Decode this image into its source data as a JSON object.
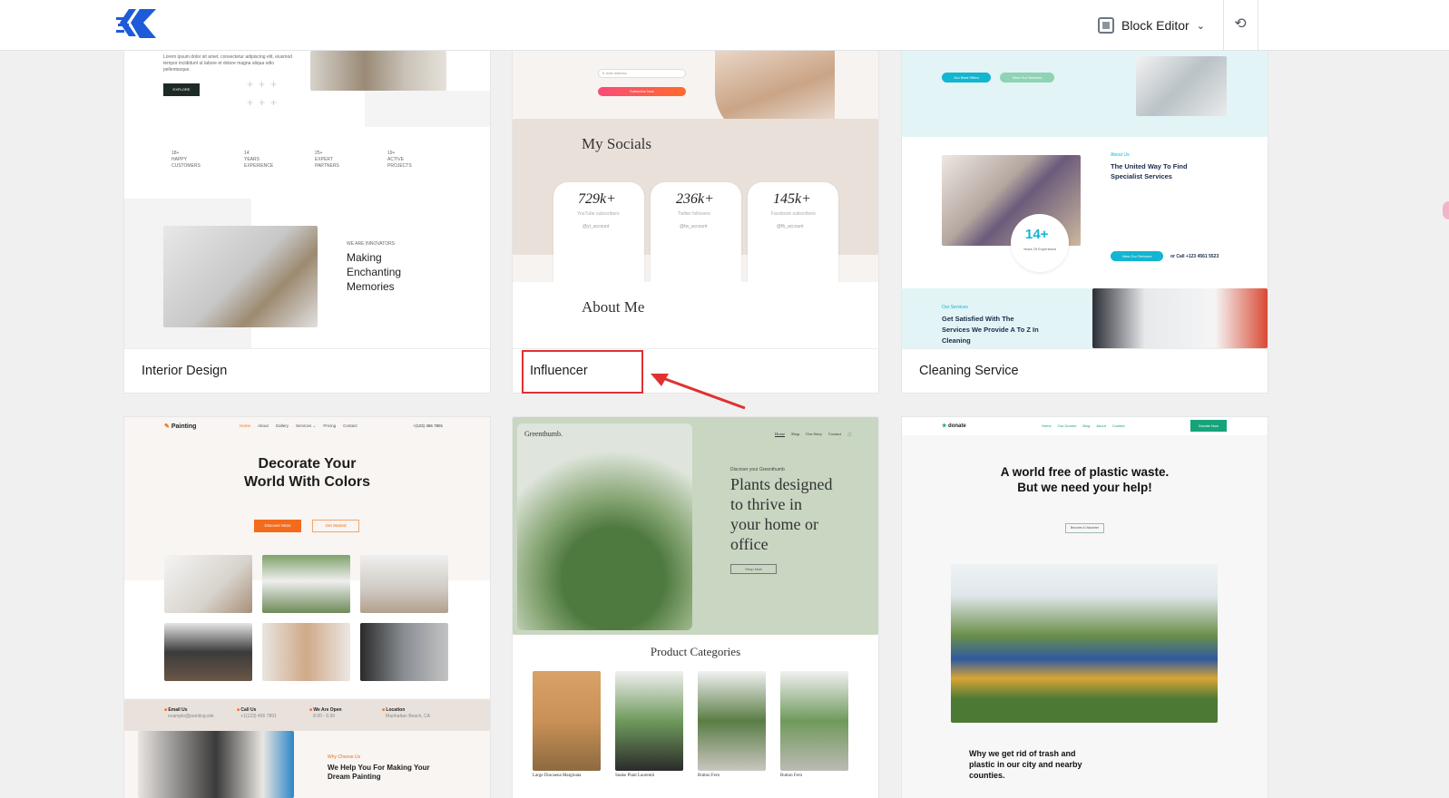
{
  "header": {
    "editor_label": "Block Editor",
    "editor_icon": "qr-block-icon",
    "sync_icon": "sync-icon"
  },
  "templates": [
    {
      "name": "Interior Design",
      "preview": {
        "stats": [
          {
            "value": "18+",
            "label": "HAPPY CUSTOMERS"
          },
          {
            "value": "14",
            "label": "YEARS EXPERIENCE"
          },
          {
            "value": "25+",
            "label": "EXPERT PARTNERS"
          },
          {
            "value": "19+",
            "label": "ACTIVE PROJECTS"
          }
        ],
        "kicker": "WE ARE INNOVATORS",
        "heading_lines": [
          "Making",
          "Enchanting",
          "Memories"
        ],
        "button": "EXPLORE",
        "body": "Lorem ipsum dolor sit amet, consectetur adipiscing elit, eiusmod tempor incididunt ut labore et dolore magna aliqua odio pellentesque."
      }
    },
    {
      "name": "Influencer",
      "preview": {
        "email_placeholder": "E-mail address",
        "subscribe": "Subscribe Now",
        "socials_title": "My Socials",
        "socials": [
          {
            "count": "729k+",
            "label": "YouTube subscribers",
            "handle": "@yt_account"
          },
          {
            "count": "236k+",
            "label": "Twitter followers",
            "handle": "@tw_account"
          },
          {
            "count": "145k+",
            "label": "Facebook subscribers",
            "handle": "@fb_account"
          }
        ],
        "about_title": "About Me"
      }
    },
    {
      "name": "Cleaning Service",
      "preview": {
        "btn_offers": "Our Best Offers",
        "btn_services": "View Our Services",
        "about_kicker": "About Us",
        "about_title_lines": [
          "The United Way To Find",
          "Specialist Services"
        ],
        "badge_value": "14+",
        "badge_label": "Years Of Experience",
        "view_btn": "View Our Services",
        "call": "or Call +123 4561 5523",
        "services_kicker": "Our Services",
        "services_title_lines": [
          "Get Satisfied With The",
          "Services We Provide A To Z In",
          "Cleaning"
        ]
      }
    },
    {
      "name": "Painting",
      "preview": {
        "brand": "Painting",
        "nav": [
          "Home",
          "About",
          "Gallery",
          "Services ⌄",
          "Pricing",
          "Contact"
        ],
        "phone": "+(123) 456 7891",
        "hero_lines": [
          "Decorate Your",
          "World With Colors"
        ],
        "btn_primary": "Discover More",
        "btn_secondary": "Get Started",
        "info": [
          {
            "title": "Email Us",
            "sub": "example@painting.site"
          },
          {
            "title": "Call Us",
            "sub": "+1(123) 456 7891"
          },
          {
            "title": "We Are Open",
            "sub": "8:00 - 5:30"
          },
          {
            "title": "Location",
            "sub": "Manhattan Beach, CA"
          }
        ],
        "why_kicker": "Why Choose Us",
        "why_lines": [
          "We Help You For Making Your",
          "Dream Painting"
        ]
      }
    },
    {
      "name": "Greenthumb",
      "preview": {
        "brand": "Greenthumb.",
        "nav": [
          "Home",
          "Shop",
          "Our Story",
          "Contact"
        ],
        "kicker": "Discover your Greenthumb",
        "hero_lines": [
          "Plants designed",
          "to thrive in",
          "your home or",
          "office"
        ],
        "btn": "Shop Now",
        "categories_title": "Product Categories",
        "categories": [
          "Large Dracaena Marginata",
          "Snake Plant Laurentii",
          "Button Fern",
          "Button Fern"
        ]
      }
    },
    {
      "name": "donate",
      "preview": {
        "brand": "donate",
        "nav": [
          "Home",
          "Our Donors",
          "Blog",
          "About",
          "Contact"
        ],
        "nav_btn": "Donate Now",
        "hero_lines": [
          "A world free of plastic waste.",
          "But we need your help!"
        ],
        "btn": "Become A Volunteer",
        "why_lines": [
          "Why we get rid of trash and",
          "plastic in our city and nearby",
          "counties."
        ]
      }
    }
  ],
  "colors": {
    "brand_blue": "#1d5bd8",
    "highlight_red": "#e03131",
    "painting_orange": "#f36b1c",
    "clean_cyan": "#13b5d0",
    "donate_green": "#17a37a",
    "influencer_gradient": [
      "#f94b7a",
      "#ff6a2b"
    ]
  }
}
